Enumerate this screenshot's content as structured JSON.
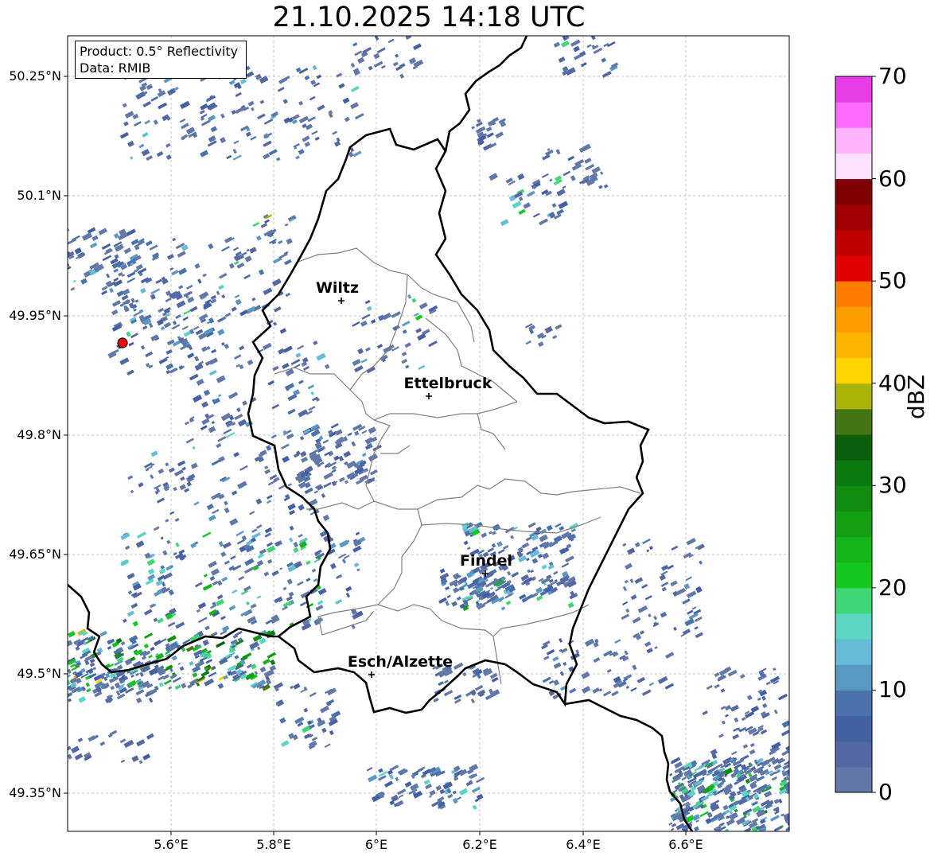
{
  "title": "21.10.2025 14:18 UTC",
  "info": {
    "product": "Product: 0.5° Reflectivity",
    "data": "Data: RMIB"
  },
  "lat_ticks": [
    "50.25°N",
    "50.1°N",
    "49.95°N",
    "49.8°N",
    "49.65°N",
    "49.5°N",
    "49.35°N"
  ],
  "lon_ticks": [
    "5.6°E",
    "5.8°E",
    "6°E",
    "6.2°E",
    "6.4°E",
    "6.6°E"
  ],
  "cities": [
    {
      "name": "Wiltz"
    },
    {
      "name": "Ettelbruck"
    },
    {
      "name": "Findel"
    },
    {
      "name": "Esch/Alzette"
    }
  ],
  "colorbar": {
    "unit": "dBZ",
    "ticks": [
      "0",
      "10",
      "20",
      "30",
      "40",
      "50",
      "60",
      "70"
    ],
    "colors": [
      "#6278a8",
      "#5468a4",
      "#4460a4",
      "#4a72ac",
      "#5a98c4",
      "#66bcd8",
      "#5cd6c4",
      "#40d676",
      "#14c81e",
      "#14b41a",
      "#12a012",
      "#108c10",
      "#0c7810",
      "#0a5e0c",
      "#467614",
      "#aab408",
      "#ffd400",
      "#ffb400",
      "#ff9c00",
      "#ff7c00",
      "#e00000",
      "#c00000",
      "#a00000",
      "#7e0000",
      "#ffe0ff",
      "#ffb4ff",
      "#ff6cff",
      "#e83ce8"
    ]
  },
  "radar_marker_color": "#ff0000"
}
